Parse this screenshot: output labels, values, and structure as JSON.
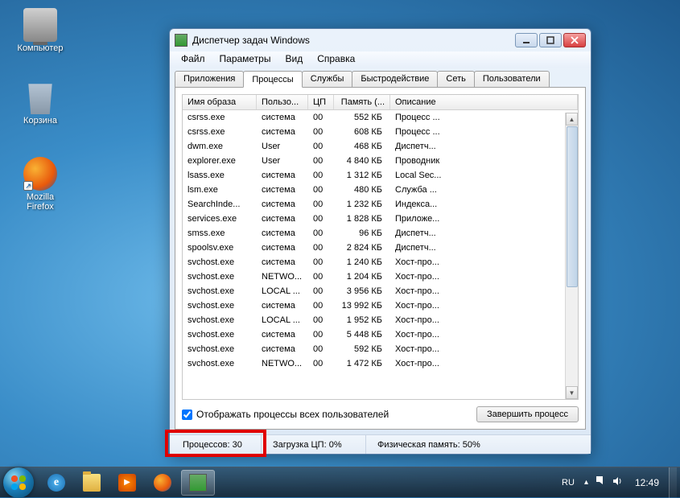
{
  "desktop": {
    "icons": [
      {
        "name": "computer",
        "label": "Компьютер"
      },
      {
        "name": "recycle-bin",
        "label": "Корзина"
      },
      {
        "name": "firefox",
        "label": "Mozilla Firefox"
      }
    ]
  },
  "window": {
    "title": "Диспетчер задач Windows",
    "menu": [
      "Файл",
      "Параметры",
      "Вид",
      "Справка"
    ],
    "tabs": [
      "Приложения",
      "Процессы",
      "Службы",
      "Быстродействие",
      "Сеть",
      "Пользователи"
    ],
    "active_tab": 1,
    "columns": [
      "Имя образа",
      "Пользо...",
      "ЦП",
      "Память (...",
      "Описание"
    ],
    "rows": [
      {
        "img": "csrss.exe",
        "user": "система",
        "cpu": "00",
        "mem": "552 КБ",
        "desc": "Процесс ..."
      },
      {
        "img": "csrss.exe",
        "user": "система",
        "cpu": "00",
        "mem": "608 КБ",
        "desc": "Процесс ..."
      },
      {
        "img": "dwm.exe",
        "user": "User",
        "cpu": "00",
        "mem": "468 КБ",
        "desc": "Диспетч..."
      },
      {
        "img": "explorer.exe",
        "user": "User",
        "cpu": "00",
        "mem": "4 840 КБ",
        "desc": "Проводник"
      },
      {
        "img": "lsass.exe",
        "user": "система",
        "cpu": "00",
        "mem": "1 312 КБ",
        "desc": "Local Sec..."
      },
      {
        "img": "lsm.exe",
        "user": "система",
        "cpu": "00",
        "mem": "480 КБ",
        "desc": "Служба ..."
      },
      {
        "img": "SearchInde...",
        "user": "система",
        "cpu": "00",
        "mem": "1 232 КБ",
        "desc": "Индекса..."
      },
      {
        "img": "services.exe",
        "user": "система",
        "cpu": "00",
        "mem": "1 828 КБ",
        "desc": "Приложе..."
      },
      {
        "img": "smss.exe",
        "user": "система",
        "cpu": "00",
        "mem": "96 КБ",
        "desc": "Диспетч..."
      },
      {
        "img": "spoolsv.exe",
        "user": "система",
        "cpu": "00",
        "mem": "2 824 КБ",
        "desc": "Диспетч..."
      },
      {
        "img": "svchost.exe",
        "user": "система",
        "cpu": "00",
        "mem": "1 240 КБ",
        "desc": "Хост-про..."
      },
      {
        "img": "svchost.exe",
        "user": "NETWO...",
        "cpu": "00",
        "mem": "1 204 КБ",
        "desc": "Хост-про..."
      },
      {
        "img": "svchost.exe",
        "user": "LOCAL ...",
        "cpu": "00",
        "mem": "3 956 КБ",
        "desc": "Хост-про..."
      },
      {
        "img": "svchost.exe",
        "user": "система",
        "cpu": "00",
        "mem": "13 992 КБ",
        "desc": "Хост-про..."
      },
      {
        "img": "svchost.exe",
        "user": "LOCAL ...",
        "cpu": "00",
        "mem": "1 952 КБ",
        "desc": "Хост-про..."
      },
      {
        "img": "svchost.exe",
        "user": "система",
        "cpu": "00",
        "mem": "5 448 КБ",
        "desc": "Хост-про..."
      },
      {
        "img": "svchost.exe",
        "user": "система",
        "cpu": "00",
        "mem": "592 КБ",
        "desc": "Хост-про..."
      },
      {
        "img": "svchost.exe",
        "user": "NETWO...",
        "cpu": "00",
        "mem": "1 472 КБ",
        "desc": "Хост-про..."
      }
    ],
    "show_all_users_label": "Отображать процессы всех пользователей",
    "show_all_users_checked": true,
    "end_process_label": "Завершить процесс",
    "status": {
      "processes": "Процессов: 30",
      "cpu": "Загрузка ЦП: 0%",
      "mem": "Физическая память: 50%"
    }
  },
  "taskbar": {
    "lang": "RU",
    "clock": "12:49"
  }
}
